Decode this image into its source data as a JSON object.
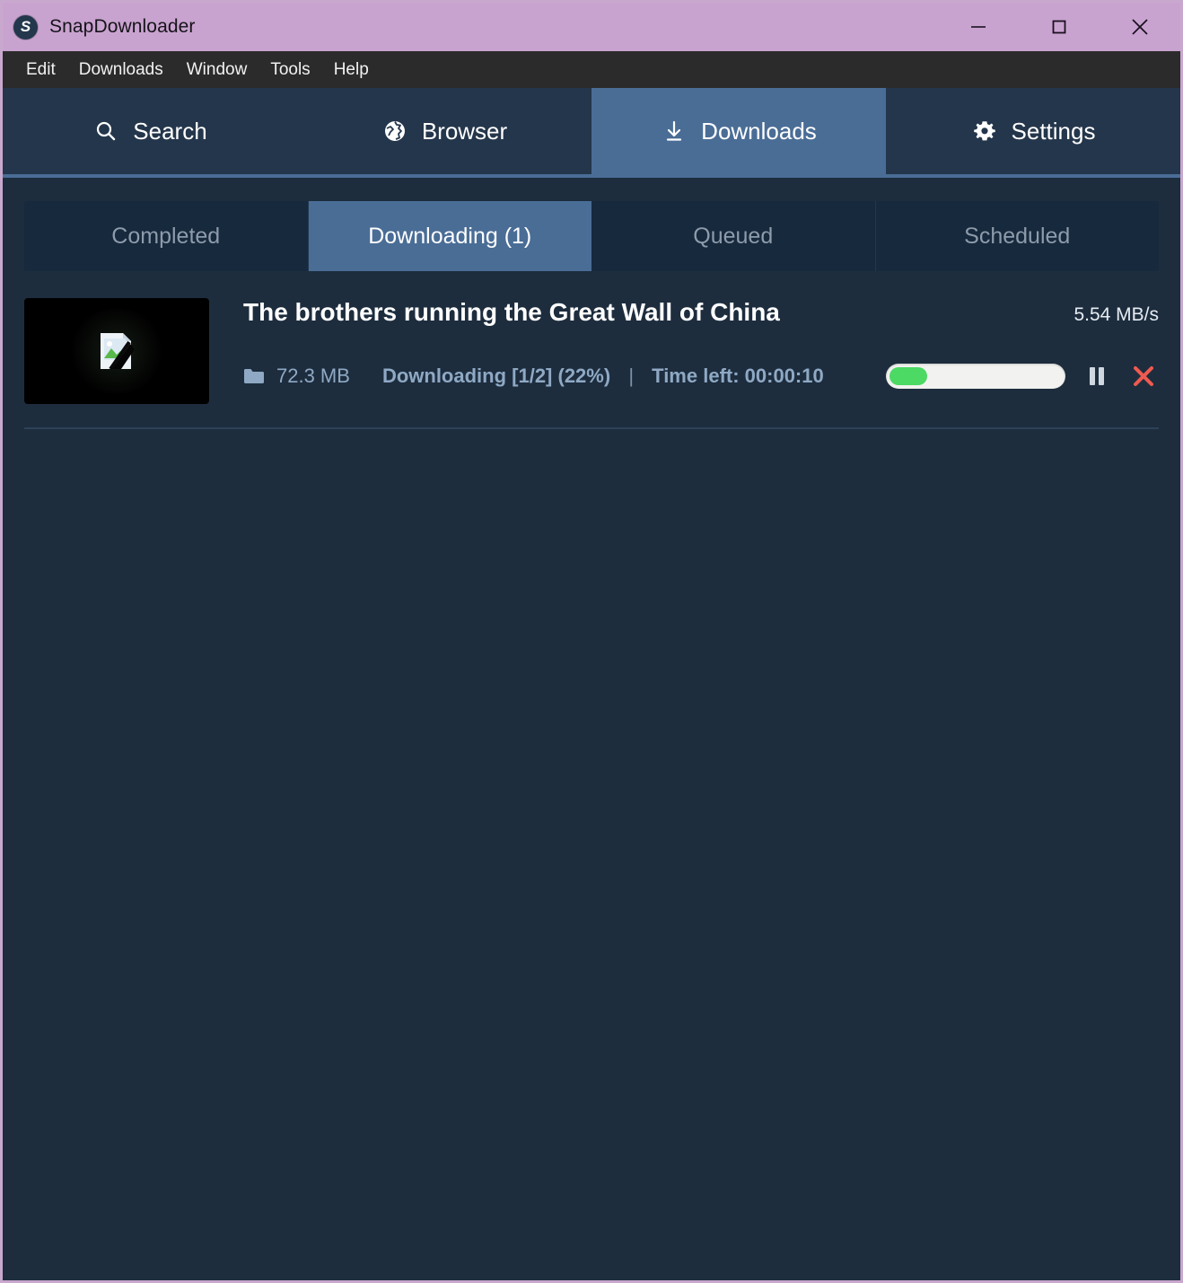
{
  "window": {
    "title": "SnapDownloader",
    "logo_letter": "S",
    "accent_title_bar": "#c9a3cf",
    "controls": [
      {
        "name": "minimize-button",
        "label": "Minimize"
      },
      {
        "name": "maximize-button",
        "label": "Maximize"
      },
      {
        "name": "close-button",
        "label": "Close"
      }
    ]
  },
  "menu_bar": {
    "items": [
      {
        "label": "Edit"
      },
      {
        "label": "Downloads"
      },
      {
        "label": "Window"
      },
      {
        "label": "Tools"
      },
      {
        "label": "Help"
      }
    ]
  },
  "main_nav": {
    "active": "Downloads",
    "tabs": [
      {
        "label": "Search",
        "icon": "search-icon",
        "active": false
      },
      {
        "label": "Browser",
        "icon": "globe-icon",
        "active": false
      },
      {
        "label": "Downloads",
        "icon": "download-icon",
        "active": true
      },
      {
        "label": "Settings",
        "icon": "gear-icon",
        "active": false
      }
    ]
  },
  "sub_tabs": {
    "active": "Downloading (1)",
    "tabs": [
      {
        "label": "Completed",
        "active": false
      },
      {
        "label": "Downloading (1)",
        "active": true
      },
      {
        "label": "Queued",
        "active": false
      },
      {
        "label": "Scheduled",
        "active": false
      }
    ]
  },
  "downloads": [
    {
      "title": "The brothers running the Great Wall of China",
      "speed": "5.54 MB/s",
      "size": "72.3 MB",
      "status": "Downloading [1/2] (22%)",
      "separator": "|",
      "time_left": "Time left: 00:00:10",
      "progress_percent": 22,
      "thumbnail_icon": "broken-image-icon",
      "controls": [
        {
          "name": "pause-button",
          "label": "Pause"
        },
        {
          "name": "cancel-button",
          "label": "Cancel"
        }
      ]
    }
  ],
  "colors": {
    "title_bar": "#c9a3cf",
    "menu_bar": "#2b2b2b",
    "nav_bar": "#24364b",
    "nav_active": "#4a6d96",
    "content_bg": "#1d2d3e",
    "sub_tab_bg": "#16293d",
    "progress_fill": "#4cd964",
    "progress_track": "#f2f2f0",
    "cancel_red": "#f05a4f",
    "meta_text": "#8fa9c4"
  }
}
